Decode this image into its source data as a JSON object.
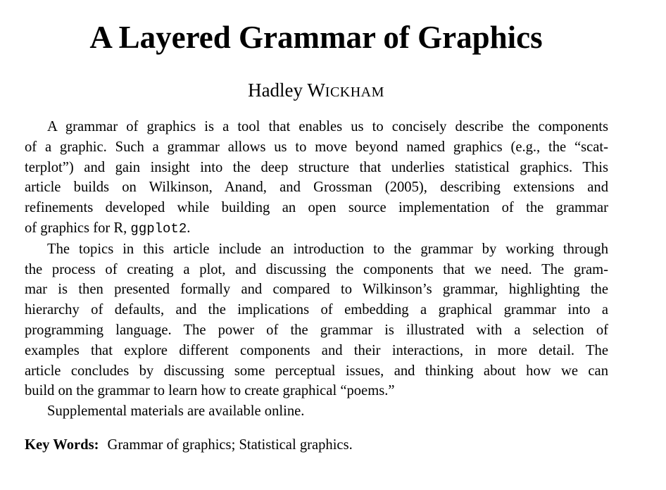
{
  "paper": {
    "title": "A Layered Grammar of Graphics",
    "author_first": "Hadley",
    "author_last_initial": "W",
    "author_last_rest": "ICKHAM",
    "abstract": {
      "para1": [
        "A grammar of graphics is a tool that enables us to concisely describe the components",
        "of a graphic. Such a grammar allows us to move beyond named graphics (e.g., the “scat-",
        "terplot”) and gain insight into the deep structure that underlies statistical graphics. This",
        "article builds on Wilkinson, Anand, and Grossman (2005), describing extensions and",
        "refinements developed while building an open source implementation of the grammar",
        "of graphics for R,"
      ],
      "para1_code": "ggplot2",
      "para1_end": ".",
      "para2": [
        "The topics in this article include an introduction to the grammar by working through",
        "the process of creating a plot, and discussing the components that we need. The gram-",
        "mar is then presented formally and compared to Wilkinson’s grammar, highlighting the",
        "hierarchy of defaults, and the implications of embedding a graphical grammar into a",
        "programming language. The power of the grammar is illustrated with a selection of",
        "examples that explore different components and their interactions, in more detail. The",
        "article concludes by discussing some perceptual issues, and thinking about how we can",
        "build on the grammar to learn how to create graphical “poems.”"
      ],
      "para3": "Supplemental materials are available online."
    },
    "keywords_label": "Key Words:",
    "keywords_value": "Grammar of graphics; Statistical graphics."
  }
}
